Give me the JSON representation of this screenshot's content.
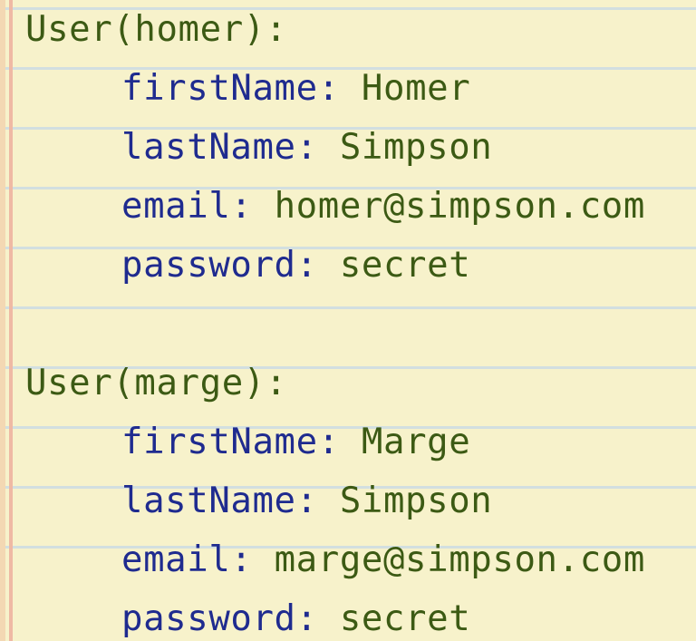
{
  "colors": {
    "background": "#f7f2cb",
    "rule_lines": "#d2dfe0",
    "margin_line": "#efb9a4",
    "header_text": "#3c5a14",
    "key_text": "#1f2b8f",
    "value_text": "#3c5a14"
  },
  "separator": ": ",
  "records": [
    {
      "header": "User(homer):",
      "fields": [
        {
          "key": "firstName",
          "value": "Homer"
        },
        {
          "key": "lastName",
          "value": "Simpson"
        },
        {
          "key": "email",
          "value": "homer@simpson.com"
        },
        {
          "key": "password",
          "value": "secret"
        }
      ]
    },
    {
      "header": "User(marge):",
      "fields": [
        {
          "key": "firstName",
          "value": "Marge"
        },
        {
          "key": "lastName",
          "value": "Simpson"
        },
        {
          "key": "email",
          "value": "marge@simpson.com"
        },
        {
          "key": "password",
          "value": "secret"
        }
      ]
    }
  ]
}
